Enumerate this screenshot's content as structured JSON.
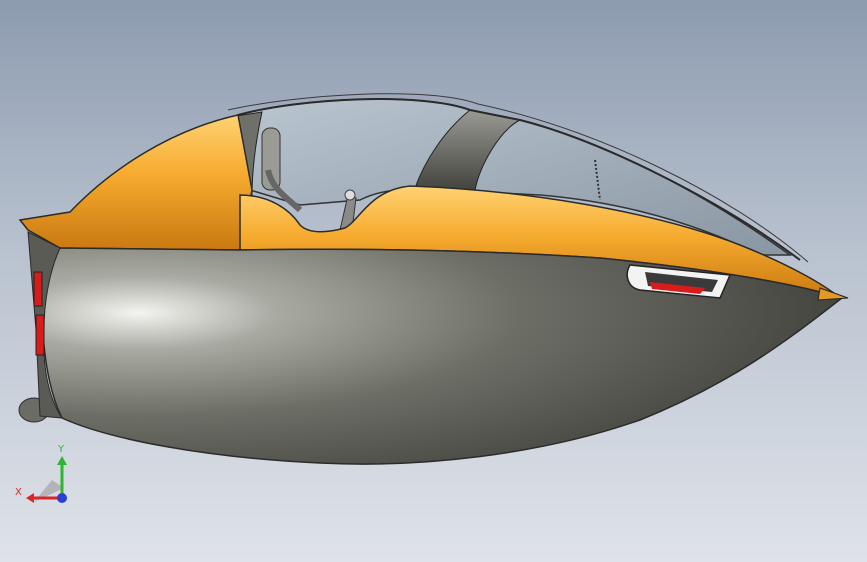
{
  "viewport": {
    "background_top": "#8d9bb0",
    "background_bottom": "#dfe3e9"
  },
  "model": {
    "hull_color": "#55564f",
    "fairing_color": "#f2a52b",
    "canopy_color": "#9aa7b3",
    "marker_color": "#d81b1b"
  },
  "triad": {
    "x_label": "X",
    "y_label": "Y",
    "x_color": "#d9262b",
    "y_color": "#2fb532",
    "z_color": "#2b3fd4"
  }
}
